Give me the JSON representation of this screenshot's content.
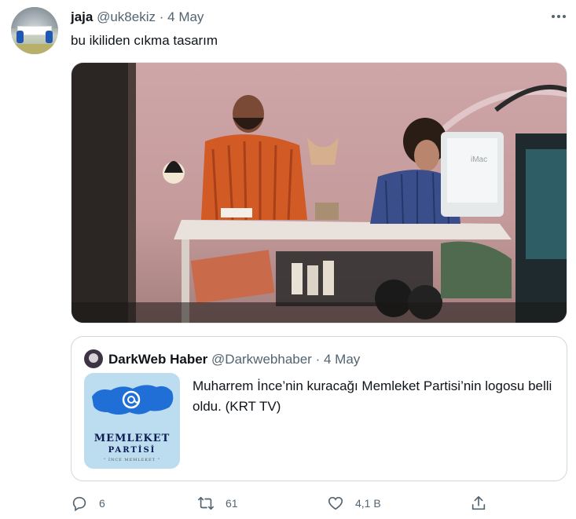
{
  "tweet": {
    "author_name": "jaja",
    "author_handle": "@uk8ekiz",
    "separator": "·",
    "date": "4 May",
    "text": "bu ikiliden cıkma tasarım",
    "media_label": "iMac"
  },
  "quoted_tweet": {
    "author_name": "DarkWeb Haber",
    "author_handle": "@Darkwebhaber",
    "separator": "·",
    "date": "4 May",
    "text": "Muharrem İnce’nin kuracağı Memleket Partisi’nin logosu belli oldu. (KRT TV)",
    "logo_line1": "MEMLEKET",
    "logo_line2": "PARTİSİ",
    "logo_line3": "\" İNCE MEMLEKET \""
  },
  "actions": {
    "reply_count": "6",
    "retweet_count": "61",
    "like_count": "4,1 B"
  },
  "icons": [
    "more-icon",
    "reply-icon",
    "retweet-icon",
    "like-icon",
    "share-icon",
    "at-sign-icon"
  ],
  "colors": {
    "text": "#0f1419",
    "secondary": "#536471",
    "border": "#cfd9de",
    "logo_blue": "#1f6fd6"
  }
}
